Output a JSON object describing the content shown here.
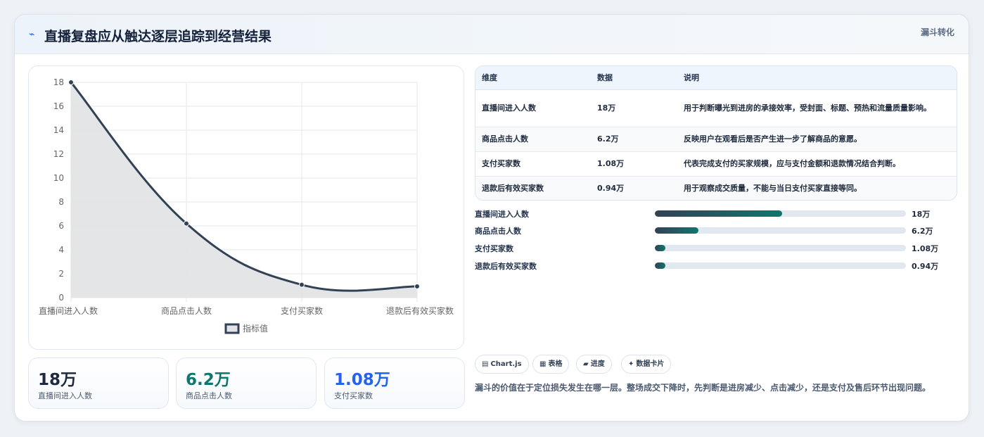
{
  "header": {
    "icon": "pulse-icon",
    "title": "直播复盘应从触达逐层追踪到经营结果",
    "badge": "漏斗转化"
  },
  "chart_data": {
    "type": "line",
    "categories": [
      "直播间进入人数",
      "商品点击人数",
      "支付买家数",
      "退款后有效买家数"
    ],
    "series": [
      {
        "name": "指标值",
        "values": [
          18,
          6.2,
          1.08,
          0.94
        ]
      }
    ],
    "y_ticks": [
      "0",
      "2",
      "4",
      "6",
      "8",
      "10",
      "12",
      "14",
      "16",
      "18"
    ],
    "ylim": [
      0,
      18
    ],
    "grid": true,
    "fill": true,
    "legend_position": "bottom",
    "colors": {
      "line": "#334155",
      "fill": "#e3e4e6"
    }
  },
  "stats": [
    {
      "value": "18万",
      "label": "直播间进入人数",
      "color": "#1f2a3c"
    },
    {
      "value": "6.2万",
      "label": "商品点击人数",
      "color": "#0f766e"
    },
    {
      "value": "1.08万",
      "label": "支付买家数",
      "color": "#2563eb"
    }
  ],
  "table": {
    "headers": [
      "维度",
      "数据",
      "说明"
    ],
    "rows": [
      {
        "dimension": "直播间进入人数",
        "data": "18万",
        "note": "用于判断曝光到进房的承接效率，受封面、标题、预热和流量质量影响。"
      },
      {
        "dimension": "商品点击人数",
        "data": "6.2万",
        "note": "反映用户在观看后是否产生进一步了解商品的意愿。"
      },
      {
        "dimension": "支付买家数",
        "data": "1.08万",
        "note": "代表完成支付的买家规模，应与支付金额和退款情况结合判断。"
      },
      {
        "dimension": "退款后有效买家数",
        "data": "0.94万",
        "note": "用于观察成交质量，不能与当日支付买家直接等同。"
      }
    ]
  },
  "progress": {
    "max": 35.5,
    "rows": [
      {
        "label": "直播间进入人数",
        "value": 18,
        "display": "18万"
      },
      {
        "label": "商品点击人数",
        "value": 6.2,
        "display": "6.2万"
      },
      {
        "label": "支付买家数",
        "value": 1.08,
        "display": "1.08万"
      },
      {
        "label": "退款后有效买家数",
        "value": 0.94,
        "display": "0.94万"
      }
    ]
  },
  "chips": [
    {
      "icon": "chart-icon",
      "glyph": "▤",
      "label": "Chart.js"
    },
    {
      "icon": "table-icon",
      "glyph": "▦",
      "label": "表格"
    },
    {
      "icon": "progress-icon",
      "glyph": "▰",
      "label": "进度"
    },
    {
      "icon": "sparkle-icon",
      "glyph": "✦",
      "label": "数据卡片"
    }
  ],
  "note": "漏斗的价值在于定位损失发生在哪一层。整场成交下降时，先判断是进房减少、点击减少，还是支付及售后环节出现问题。"
}
